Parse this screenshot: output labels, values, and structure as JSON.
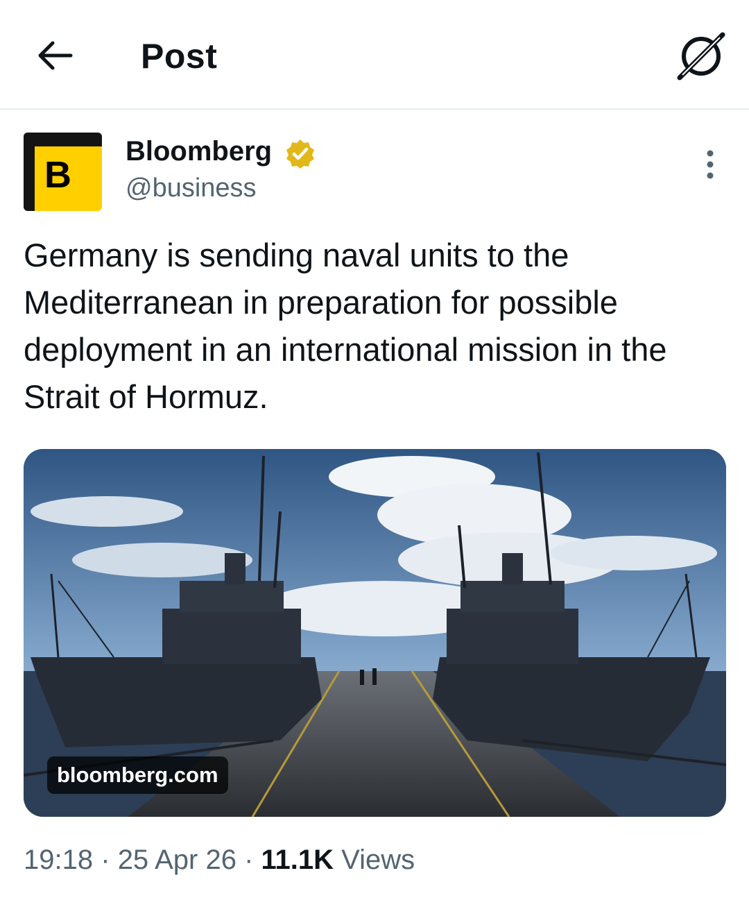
{
  "header": {
    "title": "Post"
  },
  "author": {
    "avatar_letter": "B",
    "name": "Bloomberg",
    "handle": "@business",
    "brand_color": "#ffcf00",
    "verified_color": "#e2b719"
  },
  "tweet": {
    "text": "Germany is sending naval units to the Mediterranean in preparation for possible deployment in an international mission in the Strait of Hormuz.",
    "link_label": "bloomberg.com"
  },
  "meta": {
    "time": "19:18",
    "separator": "·",
    "date": "25 Apr 26",
    "views_count": "11.1K",
    "views_label": "Views"
  },
  "icons": {
    "back": "back-arrow-icon",
    "grok": "grok-icon",
    "verified": "verified-badge-icon",
    "more": "more-vertical-icon"
  }
}
